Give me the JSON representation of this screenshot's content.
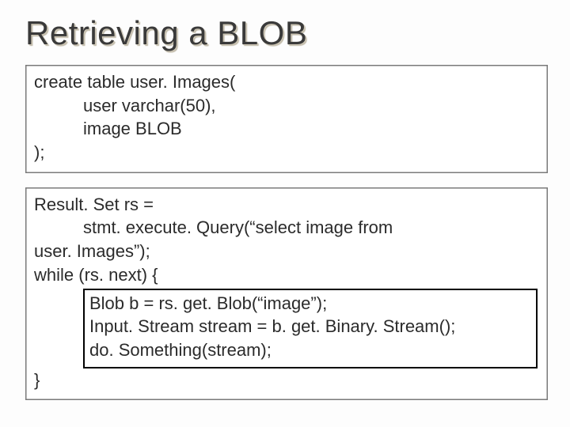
{
  "title": "Retrieving a BLOB",
  "box1": {
    "l1": "create table user. Images(",
    "l2": "user varchar(50),",
    "l3": "image BLOB",
    "l4": ");"
  },
  "box2": {
    "l1": "Result. Set rs =",
    "l2": "stmt. execute. Query(“select image from",
    "l3": "user. Images”);",
    "l4": "while (rs. next) {",
    "inner": {
      "l1": "Blob b = rs. get. Blob(“image”);",
      "l2": "Input. Stream stream = b. get. Binary. Stream();",
      "l3": "do. Something(stream);"
    },
    "l5": "}"
  }
}
